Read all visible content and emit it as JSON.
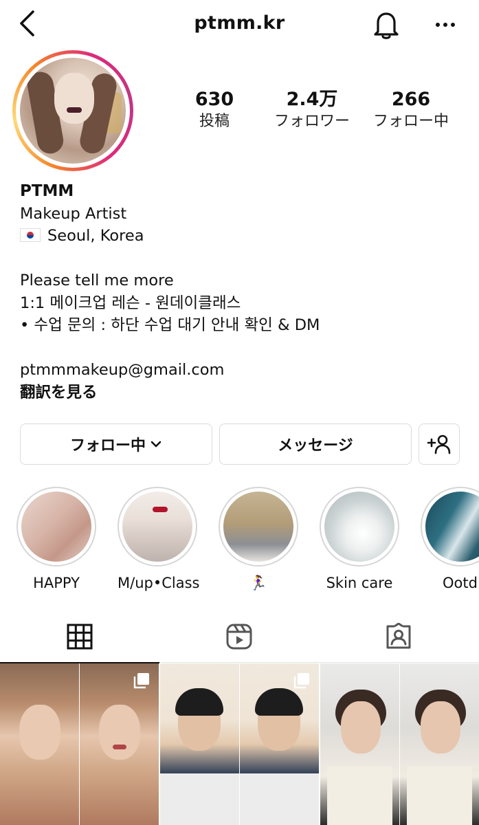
{
  "header": {
    "title": "ptmm.kr"
  },
  "profile": {
    "stats": {
      "posts_count": "630",
      "posts_label": "投稿",
      "followers_count": "2.4万",
      "followers_label": "フォロワー",
      "following_count": "266",
      "following_label": "フォロー中"
    },
    "name": "PTMM",
    "category": "Makeup Artist",
    "location": "Seoul, Korea",
    "bio_lines": [
      "Please tell me more",
      "1:1 메이크업 레슨 - 원데이클래스",
      "• 수업 문의 : 하단 수업 대기 안내 확인 & DM"
    ],
    "email": "ptmmmakeup@gmail.com",
    "translate_label": "翻訳を見る"
  },
  "actions": {
    "following_label": "フォロー中",
    "message_label": "メッセージ"
  },
  "highlights": [
    {
      "label": "HAPPY"
    },
    {
      "label": "M/up•Class"
    },
    {
      "label": "🏃‍♀️"
    },
    {
      "label": "Skin care"
    },
    {
      "label": "Ootd"
    }
  ],
  "tabs": [
    "grid",
    "reels",
    "tagged"
  ],
  "icons": {
    "back": "chevron-left-icon",
    "bell": "bell-icon",
    "more": "more-horizontal-icon",
    "add_user": "add-user-icon",
    "grid": "grid-icon",
    "reels": "reels-icon",
    "tagged": "tagged-icon",
    "multi": "multiple-posts-icon"
  },
  "colors": {
    "story_ring_start": "#f58529",
    "story_ring_end": "#dd2a7b",
    "border": "#dbdbdb",
    "text": "#111111"
  }
}
